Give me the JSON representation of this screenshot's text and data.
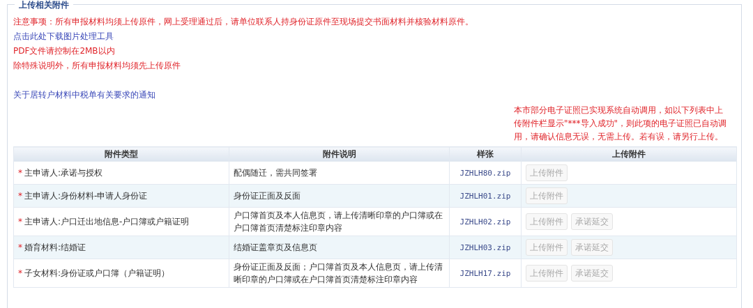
{
  "section": {
    "title": "上传相关附件"
  },
  "notices": [
    {
      "kind": "warning",
      "text": "注意事项：所有申报材料均须上传原件，网上受理通过后，请单位联系人持身份证原件至现场提交书面材料并核验材料原件。"
    },
    {
      "kind": "link",
      "text": "点击此处下载图片处理工具"
    },
    {
      "kind": "warning",
      "text": "PDF文件请控制在2MB以内"
    },
    {
      "kind": "warning",
      "text": "除特殊说明外，所有申报材料均须先上传原件"
    },
    {
      "kind": "gap"
    },
    {
      "kind": "link",
      "text": "关于居转户材料中税单有关要求的通知"
    }
  ],
  "side_note": "本市部分电子证照已实现系统自动调用，如以下列表中上传附件栏显示\"***导入成功\"，则此项的电子证照已自动调用，请确认信息无误，无需上传。若有误，请另行上传。",
  "table": {
    "columns": [
      "附件类型",
      "附件说明",
      "样张",
      "上传附件"
    ],
    "rows": [
      {
        "required_mark": "*",
        "type": "主申请人:承诺与授权",
        "description": "配偶随迁，需共同签署",
        "sample": "JZHLH80.zip",
        "buttons": [
          {
            "label": "上传附件",
            "disabled": true
          }
        ]
      },
      {
        "required_mark": "*",
        "type": "主申请人:身份材料-申请人身份证",
        "description": "身份证正面及反面",
        "sample": "JZHLH01.zip",
        "buttons": [
          {
            "label": "上传附件",
            "disabled": true
          }
        ]
      },
      {
        "required_mark": "*",
        "type": "主申请人:户口迁出地信息-户口簿或户籍证明",
        "description": "户口簿首页及本人信息页，请上传清晰印章的户口簿或在户口簿首页清楚标注印章内容",
        "sample": "JZHLH02.zip",
        "buttons": [
          {
            "label": "上传附件",
            "disabled": true
          },
          {
            "label": "承诺延交",
            "disabled": true
          }
        ]
      },
      {
        "required_mark": "*",
        "type": "婚育材料:结婚证",
        "description": "结婚证盖章页及信息页",
        "sample": "JZHLH03.zip",
        "buttons": [
          {
            "label": "上传附件",
            "disabled": true
          },
          {
            "label": "承诺延交",
            "disabled": true
          }
        ]
      },
      {
        "required_mark": "*",
        "type": "子女材料:身份证或户口簿（户籍证明）",
        "description": "身份证正面及反面；户口簿首页及本人信息页，请上传清晰印章的户口簿或在户口簿首页清楚标注印章内容",
        "sample": "JZHLH17.zip",
        "buttons": [
          {
            "label": "上传附件",
            "disabled": true
          },
          {
            "label": "承诺延交",
            "disabled": true
          }
        ]
      }
    ]
  }
}
